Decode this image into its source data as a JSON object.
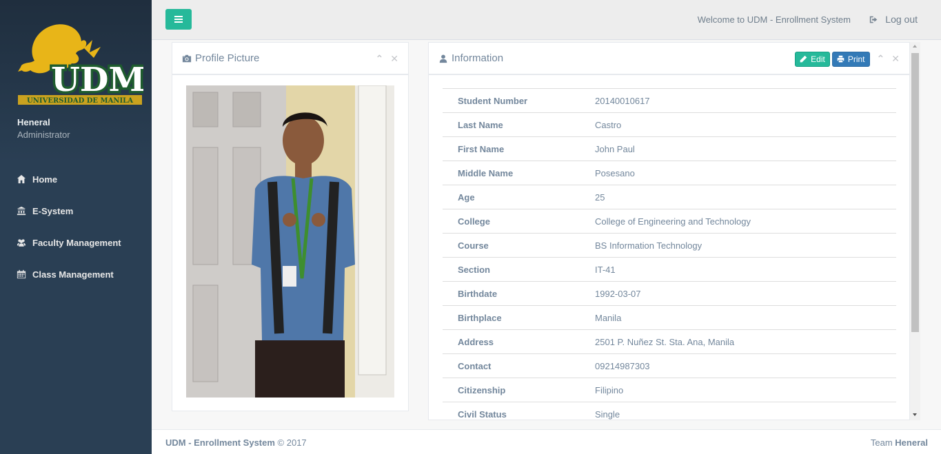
{
  "sidebar": {
    "logo": {
      "text": "UDM",
      "subtitle": "UNIVERSIDAD DE MANILA"
    },
    "profile": {
      "name": "Heneral",
      "role": "Administrator"
    },
    "items": [
      {
        "label": "Home",
        "icon": "home-icon"
      },
      {
        "label": "E-System",
        "icon": "institution-icon"
      },
      {
        "label": "Faculty Management",
        "icon": "users-icon"
      },
      {
        "label": "Class Management",
        "icon": "calendar-icon"
      }
    ]
  },
  "topnav": {
    "welcome": "Welcome to UDM - Enrollment System",
    "logout": "Log out"
  },
  "profile_panel": {
    "title": "Profile Picture"
  },
  "info_panel": {
    "title": "Information",
    "edit_label": "Edit",
    "print_label": "Print",
    "rows": [
      {
        "label": "Student Number",
        "value": "20140010617"
      },
      {
        "label": "Last Name",
        "value": "Castro"
      },
      {
        "label": "First Name",
        "value": "John Paul"
      },
      {
        "label": "Middle Name",
        "value": "Posesano"
      },
      {
        "label": "Age",
        "value": "25"
      },
      {
        "label": "College",
        "value": "College of Engineering and Technology"
      },
      {
        "label": "Course",
        "value": "BS Information Technology"
      },
      {
        "label": "Section",
        "value": "IT-41"
      },
      {
        "label": "Birthdate",
        "value": "1992-03-07"
      },
      {
        "label": "Birthplace",
        "value": "Manila"
      },
      {
        "label": "Address",
        "value": "2501 P. Nuñez St. Sta. Ana, Manila"
      },
      {
        "label": "Contact",
        "value": "09214987303"
      },
      {
        "label": "Citizenship",
        "value": "Filipino"
      },
      {
        "label": "Civil Status",
        "value": "Single"
      }
    ]
  },
  "footer": {
    "brand": "UDM - Enrollment System",
    "copyright": "© 2017",
    "team_prefix": "Team",
    "team_name": "Heneral"
  },
  "colors": {
    "sidebar": "#2A3F54",
    "accent": "#26B99A",
    "print": "#337AB7",
    "logo_gold": "#E8B518",
    "logo_green": "#1E5C2E"
  }
}
